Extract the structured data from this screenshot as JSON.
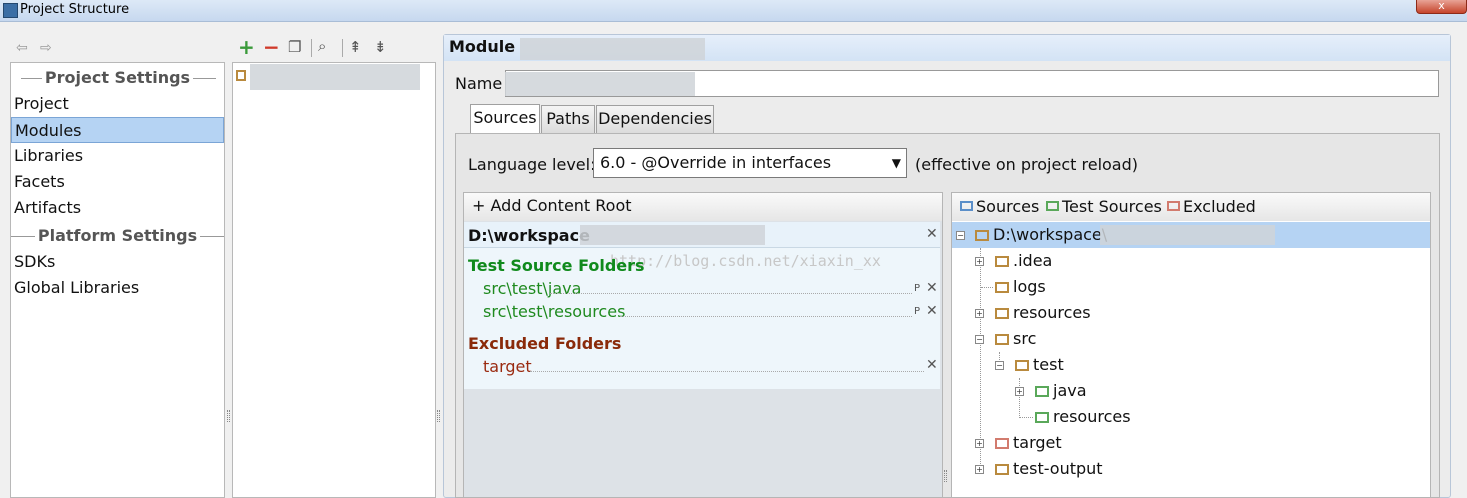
{
  "window": {
    "title": "Project Structure",
    "close_label": "x"
  },
  "toolbar": {
    "back_icon": "arrow-left-icon",
    "forward_icon": "arrow-right-icon",
    "add_label": "+",
    "remove_label": "−",
    "copy_icon": "copy-icon",
    "search_icon": "search-icon",
    "expand_icon": "expand-all-icon",
    "collapse_icon": "collapse-all-icon"
  },
  "nav": {
    "project_settings_header": "Project Settings",
    "project_items": [
      "Project",
      "Modules",
      "Libraries",
      "Facets",
      "Artifacts"
    ],
    "platform_settings_header": "Platform Settings",
    "platform_items": [
      "SDKs",
      "Global Libraries"
    ],
    "selected": "Modules"
  },
  "module": {
    "title": "Module",
    "name_label": "Name",
    "name_value": ""
  },
  "tabs": [
    "Sources",
    "Paths",
    "Dependencies"
  ],
  "sources": {
    "language_label": "Language level:",
    "language_value": "6.0 - @Override in interfaces",
    "language_note": "(effective on project reload)",
    "add_root_label": "Add Content Root",
    "root_path": "D:\\workspace",
    "watermark": "http://blog.csdn.net/xiaxin_xx",
    "test_source_header": "Test Source Folders",
    "test_folders": [
      "src\\test\\java",
      "src\\test\\resources"
    ],
    "excluded_header": "Excluded Folders",
    "excluded_folders": [
      "target"
    ]
  },
  "legend": {
    "sources": "Sources",
    "test_sources": "Test Sources",
    "excluded": "Excluded"
  },
  "tree": {
    "root": "D:\\workspace\\",
    "nodes": [
      ".idea",
      "logs",
      "resources",
      "src",
      "test",
      "java",
      "resources",
      "target",
      "test-output"
    ]
  },
  "colors": {
    "selection": "#b5d3f3",
    "test_green": "#108a1c",
    "excluded_red": "#8a2a0a"
  }
}
